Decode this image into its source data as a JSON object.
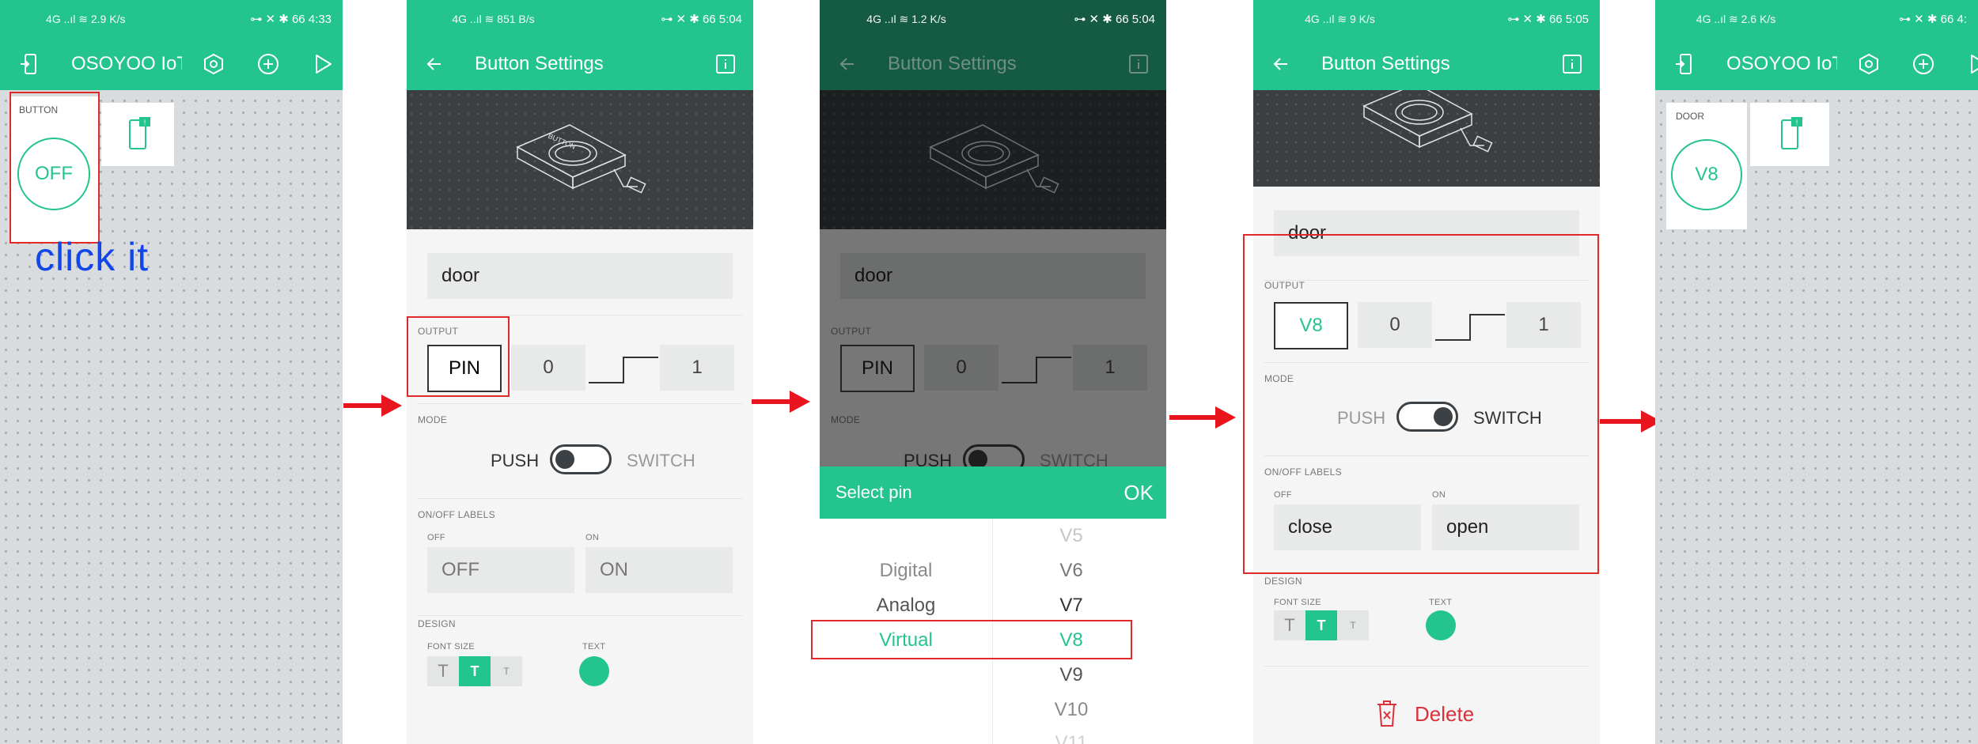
{
  "colors": {
    "accent": "#23c48e",
    "annotation": "#e02a2a",
    "hint": "#1346e8",
    "delete": "#d9323a"
  },
  "screen1": {
    "status": {
      "net": "4G ..ıl  ≋  2.9 K/s",
      "right": "⊶ ✕ ✱ 66 4:33"
    },
    "title": "OSOYOO IoT \\",
    "widget_label": "BUTTON",
    "button_text": "OFF",
    "hint": "click it"
  },
  "screen2": {
    "status": {
      "net": "4G ..ıl  ≋  851 B/s",
      "right": "⊶ ✕ ✱ 66 5:04"
    },
    "title": "Button Settings",
    "name_value": "door",
    "output_label": "OUTPUT",
    "pin": "PIN",
    "low": "0",
    "high": "1",
    "mode_label": "MODE",
    "push": "PUSH",
    "switch": "SWITCH",
    "labels_label": "ON/OFF LABELS",
    "off_label": "OFF",
    "on_label": "ON",
    "off_value": "OFF",
    "on_value": "ON",
    "design_label": "DESIGN",
    "font_size_label": "FONT SIZE",
    "text_label": "TEXT",
    "font_sizes": [
      "T",
      "T",
      "T"
    ]
  },
  "screen3": {
    "status": {
      "net": "4G ..ıl  ≋  1.2 K/s",
      "right": "⊶ ✕ ✱ 66 5:04"
    },
    "title": "Button Settings",
    "name_value": "door",
    "output_label": "OUTPUT",
    "pin": "PIN",
    "low": "0",
    "high": "1",
    "mode_label": "MODE",
    "push": "PUSH",
    "switch": "SWITCH",
    "sheet_title": "Select pin",
    "sheet_ok": "OK",
    "types": [
      "Digital",
      "Analog",
      "Virtual"
    ],
    "pins": [
      "V5",
      "V6",
      "V7",
      "V8",
      "V9",
      "V10",
      "V11"
    ],
    "selected_type": "Virtual",
    "selected_pin": "V8"
  },
  "screen4": {
    "status": {
      "net": "4G ..ıl  ≋  9 K/s",
      "right": "⊶ ✕ ✱ 66 5:05"
    },
    "title": "Button Settings",
    "name_value": "door",
    "output_label": "OUTPUT",
    "pin": "V8",
    "low": "0",
    "high": "1",
    "mode_label": "MODE",
    "push": "PUSH",
    "switch": "SWITCH",
    "labels_label": "ON/OFF LABELS",
    "off_label": "OFF",
    "on_label": "ON",
    "off_value": "close",
    "on_value": "open",
    "design_label": "DESIGN",
    "font_size_label": "FONT SIZE",
    "text_label": "TEXT",
    "font_sizes": [
      "T",
      "T",
      "T"
    ],
    "delete": "Delete"
  },
  "screen5": {
    "status": {
      "net": "4G ..ıl  ≋  2.6 K/s",
      "right": "⊶ ✕ ✱ 66 4:"
    },
    "title": "OSOYOO IoT \\",
    "widget_label": "DOOR",
    "button_text": "V8"
  },
  "icons": [
    "smartphone-icon",
    "back-arrow-icon",
    "info-icon",
    "device-icon",
    "add-icon",
    "play-icon",
    "right-arrow-icon",
    "trash-icon"
  ]
}
